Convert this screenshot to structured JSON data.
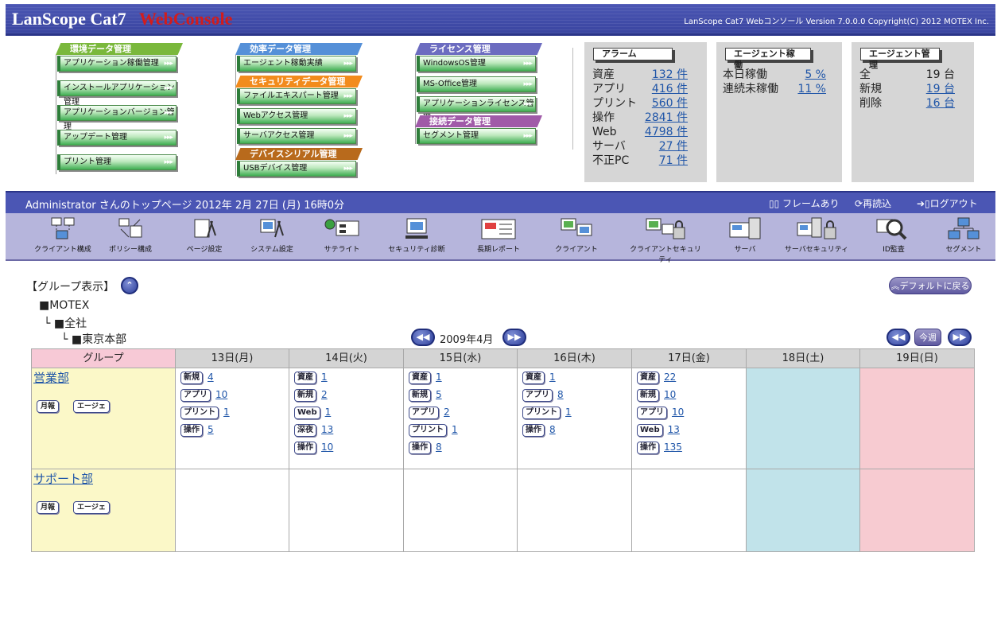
{
  "header": {
    "logo_main": "LanScope Cat7",
    "logo_sub": "WebConsole",
    "copyright": "LanScope Cat7 Webコンソール Version 7.0.0.0 Copyright(C) 2012 MOTEX Inc."
  },
  "menus": {
    "env": {
      "title": "環境データ管理",
      "items": [
        "アプリケーション稼働管理",
        "インストールアプリケーション管理",
        "アプリケーションバージョン管理",
        "アップデート管理",
        "プリント管理"
      ]
    },
    "eff": {
      "title": "効率データ管理",
      "items": [
        "エージェント稼動実績"
      ]
    },
    "sec": {
      "title": "セキュリティデータ管理",
      "items": [
        "ファイルエキスパート管理",
        "Webアクセス管理",
        "サーバアクセス管理"
      ]
    },
    "dev": {
      "title": "デバイスシリアル管理",
      "items": [
        "USBデバイス管理"
      ]
    },
    "lic": {
      "title": "ライセンス管理",
      "items": [
        "WindowsOS管理",
        "MS-Office管理",
        "アプリケーションライセンス管理"
      ]
    },
    "conn": {
      "title": "接続データ管理",
      "items": [
        "セグメント管理"
      ]
    },
    "arrow": "▸▸▸"
  },
  "alarm": {
    "title": "アラーム",
    "rows": [
      {
        "label": "資産",
        "value": "132 件"
      },
      {
        "label": "アプリ",
        "value": "416 件"
      },
      {
        "label": "プリント",
        "value": "560 件"
      },
      {
        "label": "操作",
        "value": "2841 件"
      },
      {
        "label": "Web",
        "value": "4798 件"
      },
      {
        "label": "サーバ",
        "value": "27 件"
      },
      {
        "label": "不正PC",
        "value": "71 件"
      }
    ]
  },
  "agent_run": {
    "title": "エージェント稼働",
    "rows": [
      {
        "label": "本日稼働",
        "value": "5 %"
      },
      {
        "label": "連続未稼働",
        "value": "11 %"
      }
    ]
  },
  "agent_mgmt": {
    "title": "エージェント管理",
    "rows": [
      {
        "label": "全",
        "value": "19 台"
      },
      {
        "label": "新規",
        "value": "19 台"
      },
      {
        "label": "削除",
        "value": "16 台"
      }
    ]
  },
  "adminbar": {
    "text": "Administrator さんのトップページ 2012年 2月 27日 (月) 16時0分",
    "frame": "フレームあり",
    "reload": "再読込",
    "logout": "ログアウト"
  },
  "toolbar": [
    "クライアント構成",
    "ポリシー構成",
    "ページ設定",
    "システム設定",
    "サテライト",
    "セキュリティ診断",
    "長期レポート",
    "クライアント",
    "クライアントセキュリティ",
    "サーバ",
    "サーバセキュリティ",
    "ID監査",
    "セグメント"
  ],
  "group": {
    "title": "【グループ表示】",
    "default_btn": "デフォルトに戻る",
    "tree": [
      "■MOTEX",
      "└ ■全社",
      "└ ■東京本部"
    ],
    "month": "2009年4月",
    "today": "今週"
  },
  "calendar": {
    "group_header": "グループ",
    "days": [
      "13日(月)",
      "14日(火)",
      "15日(水)",
      "16日(木)",
      "17日(金)",
      "18日(土)",
      "19日(日)"
    ],
    "groups": [
      {
        "name": "営業部",
        "btn1": "月報",
        "btn2": "エージェ",
        "cells": [
          [
            {
              "tag": "新規",
              "n": "4"
            },
            {
              "tag": "アプリ",
              "n": "10"
            },
            {
              "tag": "プリント",
              "n": "1"
            },
            {
              "tag": "操作",
              "n": "5"
            }
          ],
          [
            {
              "tag": "資産",
              "n": "1"
            },
            {
              "tag": "新規",
              "n": "2"
            },
            {
              "tag": "Web",
              "n": "1"
            },
            {
              "tag": "深夜",
              "n": "13"
            },
            {
              "tag": "操作",
              "n": "10"
            }
          ],
          [
            {
              "tag": "資産",
              "n": "1"
            },
            {
              "tag": "新規",
              "n": "5"
            },
            {
              "tag": "アプリ",
              "n": "2"
            },
            {
              "tag": "プリント",
              "n": "1"
            },
            {
              "tag": "操作",
              "n": "8"
            }
          ],
          [
            {
              "tag": "資産",
              "n": "1"
            },
            {
              "tag": "アプリ",
              "n": "8"
            },
            {
              "tag": "プリント",
              "n": "1"
            },
            {
              "tag": "操作",
              "n": "8"
            }
          ],
          [
            {
              "tag": "資産",
              "n": "22"
            },
            {
              "tag": "新規",
              "n": "10"
            },
            {
              "tag": "アプリ",
              "n": "10"
            },
            {
              "tag": "Web",
              "n": "13"
            },
            {
              "tag": "操作",
              "n": "135"
            }
          ],
          [],
          []
        ]
      },
      {
        "name": "サポート部",
        "btn1": "月報",
        "btn2": "エージェ",
        "cells": [
          [],
          [],
          [],
          [],
          [],
          [],
          []
        ]
      }
    ]
  },
  "colors": {
    "banner": "#4b56b4",
    "toolbar": "#b6b5dc",
    "env_head": "#7ab83c",
    "eff_head": "#5590d8",
    "sec_head": "#f28b1c",
    "dev_head": "#b86a1c",
    "lic_head": "#6c6cc0",
    "conn_head": "#a05aa8"
  }
}
